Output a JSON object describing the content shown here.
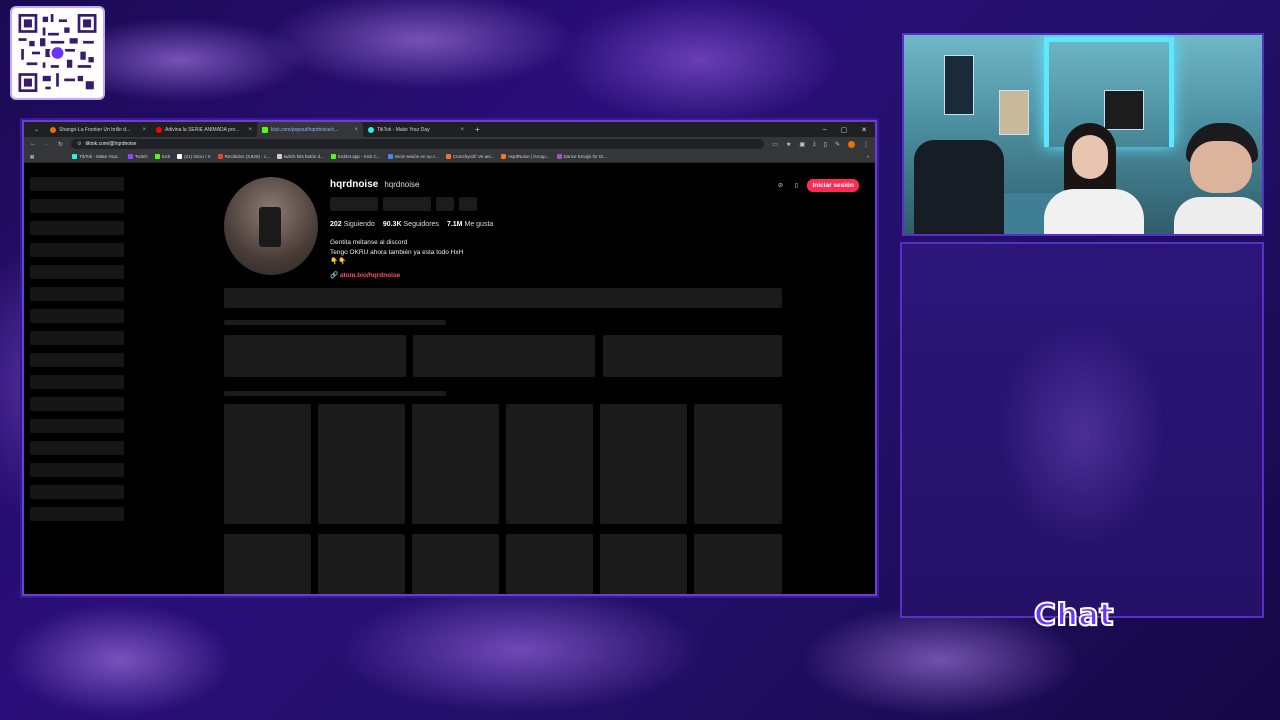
{
  "browser": {
    "tabs": [
      {
        "title": "Shangri-La Frontier Un brillo d...",
        "color": "#e8710a"
      },
      {
        "title": "Adivina la SERIE ANIMADA por...",
        "color": "#ff0000"
      },
      {
        "title": "kick.com/popout/hqrdnoise/c...",
        "color": "#53fc18",
        "active": true
      },
      {
        "title": "TikTok - Make Your Day",
        "color": "#25f4ee"
      }
    ],
    "tab_close": "×",
    "new_tab": "+",
    "window_controls": [
      "–",
      "▢",
      "✕"
    ],
    "address": "tiktok.com/@hqrdnoise",
    "bookmarks": [
      {
        "label": "TikTok - Make Your...",
        "color": "#25f4ee"
      },
      {
        "label": "Twitch",
        "color": "#9146ff"
      },
      {
        "label": "Kick",
        "color": "#53fc18"
      },
      {
        "label": "(21) Inicio / X",
        "color": "#ffffff"
      },
      {
        "label": "Recibidos (3,628) - c...",
        "color": "#ea4335"
      },
      {
        "label": "twitch bits botón d...",
        "color": "#cccccc"
      },
      {
        "label": "Kicklet.app - Kick C...",
        "color": "#53fc18"
      },
      {
        "label": "Inicie sesión en su c...",
        "color": "#4285f4"
      },
      {
        "label": "Crunchyroll: Ve ani...",
        "color": "#f47521"
      },
      {
        "label": "HqrdNoise | Group...",
        "color": "#f47521"
      },
      {
        "label": "Dance Emojis for Di...",
        "color": "#9b59b6"
      }
    ]
  },
  "profile": {
    "username": "hqrdnoise",
    "nickname": "hqrdnoise",
    "following_count": "202",
    "following_label": "Siguiendo",
    "followers_count": "90.3K",
    "followers_label": "Seguidores",
    "likes_count": "7.1M",
    "likes_label": "Me gusta",
    "bio_line1": "Gentita métanse al discord",
    "bio_line2": "Tengo OKRU ahora también ya esta todo HxH",
    "bio_line3": "👇👇",
    "link": "atom.bio/hqrdnoise",
    "login_button": "Iniciar sesión"
  },
  "overlay": {
    "chat_label": "Chat"
  },
  "colors": {
    "accent": "#6b35ff",
    "tiktok_red": "#fe2c55",
    "frame": "#5a2fc8"
  }
}
